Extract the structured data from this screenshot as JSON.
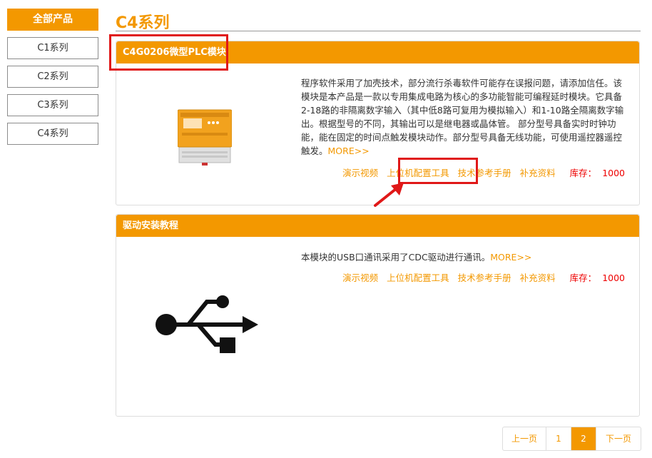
{
  "sidebar": {
    "header": "全部产品",
    "items": [
      {
        "label": "C1系列"
      },
      {
        "label": "C2系列"
      },
      {
        "label": "C3系列"
      },
      {
        "label": "C4系列"
      }
    ]
  },
  "page_title": "C4系列",
  "products": [
    {
      "title": "C4G0206微型PLC模块",
      "description": "程序软件采用了加壳技术，部分流行杀毒软件可能存在误报问题，请添加信任。该模块是本产品是一款以专用集成电路为核心的多功能智能可编程延时模块。它具备2-18路的非隔离数字输入（其中低8路可复用为模拟输入）和1-10路全隔离数字输出。根据型号的不同，其输出可以是继电器或晶体管。 部分型号具备实时时钟功能，能在固定的时间点触发模块动作。部分型号具备无线功能，可使用遥控器遥控触发。",
      "more": "MORE>>",
      "links": [
        "演示视频",
        "上位机配置工具",
        "技术参考手册",
        "补充资料"
      ],
      "stock_label": "库存：",
      "stock_value": "1000"
    },
    {
      "title": "驱动安装教程",
      "description": "本模块的USB口通讯采用了CDC驱动进行通讯。",
      "more": "MORE>>",
      "links": [
        "演示视频",
        "上位机配置工具",
        "技术参考手册",
        "补充资料"
      ],
      "stock_label": "库存：",
      "stock_value": "1000"
    }
  ],
  "pagination": {
    "prev": "上一页",
    "pages": [
      "1",
      "2"
    ],
    "current": "2",
    "next": "下一页"
  },
  "colors": {
    "accent": "#f39800",
    "highlight_box": "#e01818",
    "stock": "#e00000"
  }
}
